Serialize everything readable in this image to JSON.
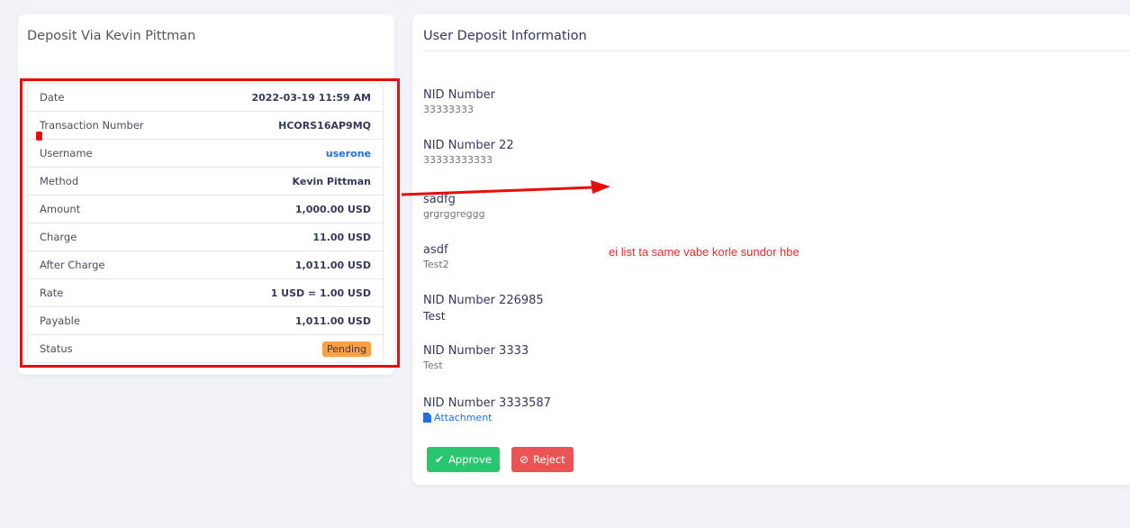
{
  "left_card": {
    "title": "Deposit Via Kevin Pittman",
    "rows": [
      {
        "label": "Date",
        "value": "2022-03-19 11:59 AM"
      },
      {
        "label": "Transaction Number",
        "value": "HCORS16AP9MQ"
      },
      {
        "label": "Username",
        "value": "userone"
      },
      {
        "label": "Method",
        "value": "Kevin Pittman"
      },
      {
        "label": "Amount",
        "value": "1,000.00 USD"
      },
      {
        "label": "Charge",
        "value": "11.00 USD"
      },
      {
        "label": "After Charge",
        "value": "1,011.00 USD"
      },
      {
        "label": "Rate",
        "value": "1 USD = 1.00 USD"
      },
      {
        "label": "Payable",
        "value": "1,011.00 USD"
      },
      {
        "label": "Status",
        "value": "Pending"
      }
    ]
  },
  "right_card": {
    "title": "User Deposit Information",
    "fields": [
      {
        "label": "NID Number",
        "value": "33333333"
      },
      {
        "label": "NID Number 22",
        "value": "33333333333"
      },
      {
        "label": "sadfg",
        "value": "grgrggreggg"
      },
      {
        "label": "asdf",
        "value": "Test2"
      },
      {
        "label": "NID Number 226985",
        "value": "Test"
      },
      {
        "label": "NID Number 3333",
        "value": "Test"
      },
      {
        "label": "NID Number 3333587",
        "value": "Attachment"
      }
    ],
    "approve_label": "Approve",
    "reject_label": "Reject"
  },
  "annotation": {
    "note": "ei list ta same vabe korle sundor hbe",
    "color": "#e80c0c"
  },
  "colors": {
    "approve": "#28c76f",
    "reject": "#ea5455",
    "pending_badge": "#f8a043",
    "link": "#1f6fe5"
  },
  "icons": {
    "approve": "check-icon",
    "reject": "ban-icon",
    "attachment": "file-icon"
  }
}
